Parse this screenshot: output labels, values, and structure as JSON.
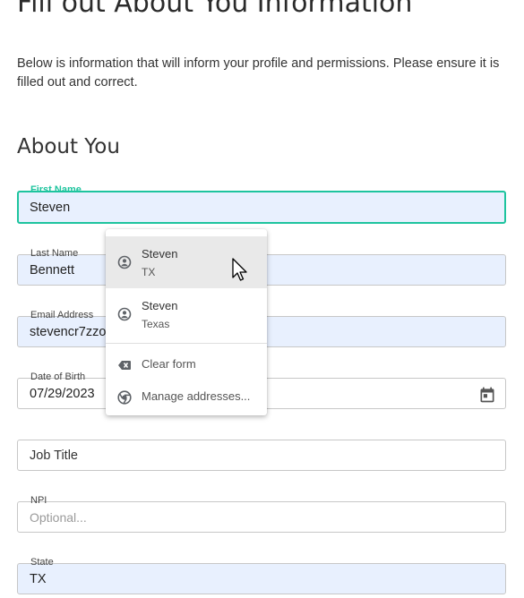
{
  "page": {
    "title": "Fill out About You Information",
    "intro": "Below is information that will inform your profile and permissions. Please ensure it is filled out and correct.",
    "section_title": "About You"
  },
  "fields": {
    "first_name": {
      "label": "First Name",
      "value": "Steven"
    },
    "last_name": {
      "label": "Last Name",
      "value": "Bennett"
    },
    "email": {
      "label": "Email Address",
      "value": "stevencr7zzo"
    },
    "dob": {
      "label": "Date of Birth",
      "value": "07/29/2023"
    },
    "job_title": {
      "placeholder": "Job Title"
    },
    "npi": {
      "label": "NPI",
      "placeholder": "Optional..."
    },
    "state": {
      "label": "State",
      "value": "TX"
    }
  },
  "autofill": {
    "suggestions": [
      {
        "main": "Steven",
        "sub": "TX",
        "icon": "person-circle-icon"
      },
      {
        "main": "Steven",
        "sub": "Texas",
        "icon": "person-circle-icon"
      }
    ],
    "actions": [
      {
        "label": "Clear form",
        "icon": "backspace-icon"
      },
      {
        "label": "Manage addresses...",
        "icon": "chrome-icon"
      }
    ]
  },
  "colors": {
    "focus_accent": "#1ec49e",
    "autofill_background": "#e8f0fe",
    "menu_highlight": "#e9e9e9"
  }
}
